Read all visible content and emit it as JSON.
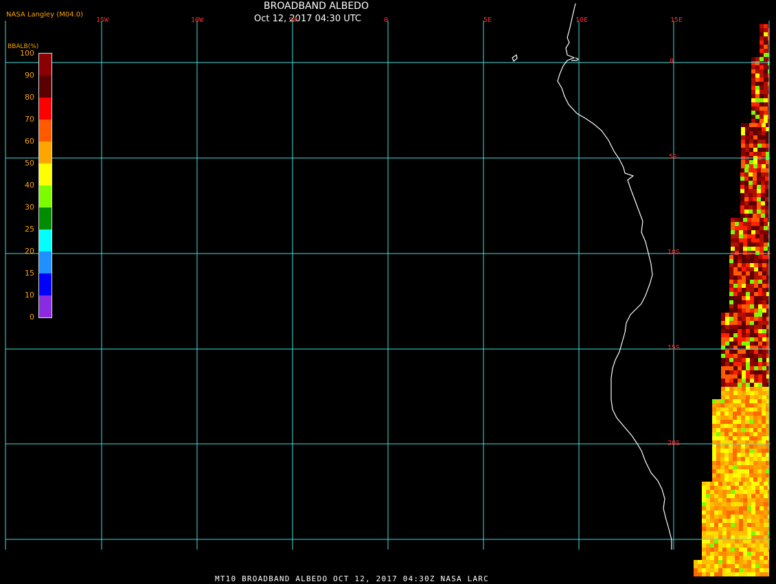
{
  "header": {
    "title": "BROADBAND ALBEDO",
    "datetime": "Oct 12, 2017 04:30 UTC",
    "source": "NASA Langley (M04.0)"
  },
  "axes": {
    "longitude_labels": [
      "15W",
      "10W",
      "5W",
      "0",
      "5E",
      "10E",
      "15E"
    ],
    "latitude_labels": [
      "0",
      "5S",
      "10S",
      "15S",
      "20S"
    ],
    "grid_color": "#40e0e0"
  },
  "colorbar": {
    "title": "BBALB(%)",
    "ticks": [
      "100",
      "90",
      "80",
      "70",
      "60",
      "50",
      "40",
      "30",
      "25",
      "20",
      "15",
      "10",
      "0"
    ],
    "colors": [
      "#8b0000",
      "#5a0000",
      "#ff0000",
      "#ff5a00",
      "#ffa500",
      "#ffff00",
      "#7cfc00",
      "#008b00",
      "#00ffff",
      "#1e90ff",
      "#0000ff",
      "#8a2be2"
    ]
  },
  "footer": {
    "caption": "MT10  BROADBAND ALBEDO   OCT 12, 2017 04:30Z   NASA LARC"
  }
}
